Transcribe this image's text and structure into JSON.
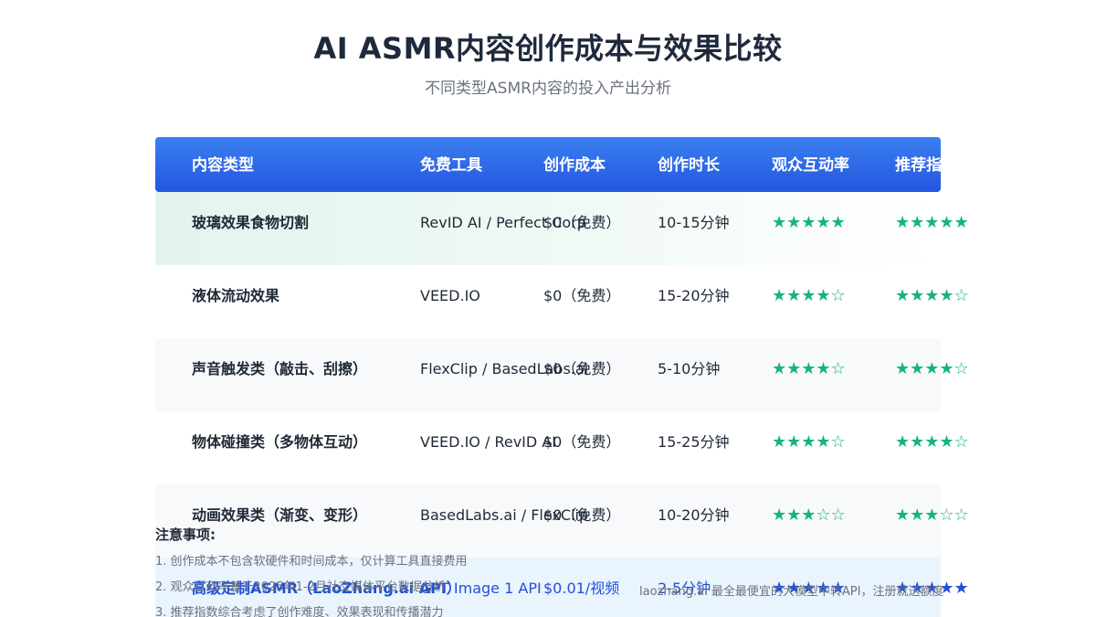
{
  "title": "AI ASMR内容创作成本与效果比较",
  "subtitle": "不同类型ASMR内容的投入产出分析",
  "columns": [
    "内容类型",
    "免费工具",
    "创作成本",
    "创作时长",
    "观众互动率",
    "推荐指数"
  ],
  "rows": [
    {
      "type": "玻璃效果食物切割",
      "tool": "RevID AI / Perfect Corp",
      "cost": "$0（免费）",
      "duration": "10-15分钟",
      "engagement": "★★★★★",
      "rating": "★★★★★"
    },
    {
      "type": "液体流动效果",
      "tool": "VEED.IO",
      "cost": "$0（免费）",
      "duration": "15-20分钟",
      "engagement": "★★★★☆",
      "rating": "★★★★☆"
    },
    {
      "type": "声音触发类（敲击、刮擦）",
      "tool": "FlexClip / BasedLabs.ai",
      "cost": "$0（免费）",
      "duration": "5-10分钟",
      "engagement": "★★★★☆",
      "rating": "★★★★☆"
    },
    {
      "type": "物体碰撞类（多物体互动）",
      "tool": "VEED.IO / RevID AI",
      "cost": "$0（免费）",
      "duration": "15-25分钟",
      "engagement": "★★★★☆",
      "rating": "★★★★☆"
    },
    {
      "type": "动画效果类（渐变、变形）",
      "tool": "BasedLabs.ai / FlexClip",
      "cost": "$0（免费）",
      "duration": "10-20分钟",
      "engagement": "★★★☆☆",
      "rating": "★★★☆☆"
    },
    {
      "type": "高级定制ASMR（LaoZhang.ai API）",
      "tool": "GPT Image 1 API",
      "cost": "$0.01/视频",
      "duration": "2-5分钟",
      "engagement": "★★★★★",
      "rating": "★★★★★"
    }
  ],
  "notes": {
    "title": "注意事项:",
    "items": [
      "1. 创作成本不包含软硬件和时间成本，仅计算工具直接费用",
      "2. 观众互动率基于2025年1-2月社交媒体平台数据分析",
      "3. 推荐指数综合考虑了创作难度、效果表现和传播潜力"
    ]
  },
  "footer": "laozhang.ai 最全最便宜的大模型中转API，注册就送额度",
  "colors": {
    "header_start": "#3b7ff0",
    "header_end": "#2356e0",
    "star_green": "#16b47a",
    "highlight_blue": "#2150d9"
  }
}
